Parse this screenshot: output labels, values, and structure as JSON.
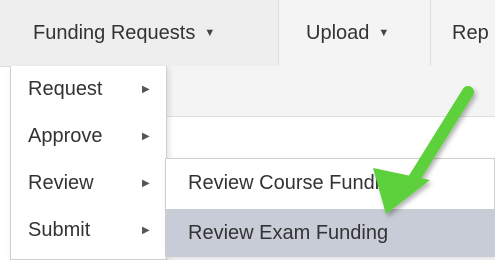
{
  "navbar": {
    "items": [
      {
        "label": "Funding Requests",
        "caret": "▼"
      },
      {
        "label": "Upload",
        "caret": "▼"
      },
      {
        "label": "Rep"
      }
    ]
  },
  "dropdown": {
    "items": [
      {
        "label": "Request",
        "arrow": "▶"
      },
      {
        "label": "Approve",
        "arrow": "▶"
      },
      {
        "label": "Review",
        "arrow": "▶"
      },
      {
        "label": "Submit",
        "arrow": "▶"
      }
    ]
  },
  "submenu": {
    "items": [
      {
        "label": "Review Course Funding"
      },
      {
        "label": "Review Exam Funding",
        "highlighted": true
      }
    ]
  },
  "annotation": {
    "icon": "green-arrow-icon",
    "color": "#5cd13a"
  }
}
